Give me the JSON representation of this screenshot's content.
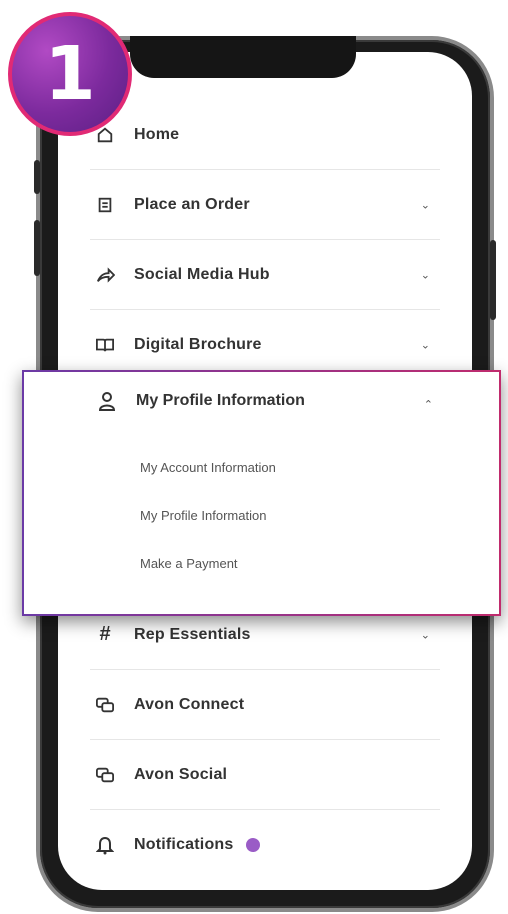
{
  "badge": {
    "number": "1"
  },
  "menu": {
    "items": [
      {
        "label": "Home",
        "icon": "home-icon",
        "chevron": ""
      },
      {
        "label": "Place an Order",
        "icon": "order-icon",
        "chevron": "⌄"
      },
      {
        "label": "Social Media Hub",
        "icon": "share-icon",
        "chevron": "⌄"
      },
      {
        "label": "Digital Brochure",
        "icon": "book-icon",
        "chevron": "⌄"
      },
      {
        "label": "Rep Essentials",
        "icon": "hash-icon",
        "chevron": "⌄"
      },
      {
        "label": "Avon Connect",
        "icon": "chat-icon",
        "chevron": ""
      },
      {
        "label": "Avon Social",
        "icon": "chat-icon",
        "chevron": ""
      },
      {
        "label": "Notifications",
        "icon": "bell-icon",
        "chevron": ""
      }
    ],
    "expanded": {
      "label": "My Profile Information",
      "icon": "user-icon",
      "chevron": "⌃",
      "subitems": [
        "My Account Information",
        "My Profile Information",
        "Make a Payment"
      ]
    }
  },
  "colors": {
    "accent": "#9a5cc6",
    "badge": "#7c2a9d",
    "highlight_border_left": "#6b3aa6",
    "highlight_border_right": "#c02b6d"
  }
}
